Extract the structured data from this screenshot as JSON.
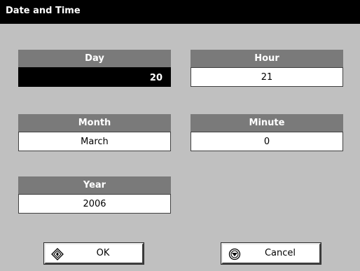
{
  "window": {
    "title": "Date and Time"
  },
  "fields": {
    "day": {
      "label": "Day",
      "value": "20"
    },
    "hour": {
      "label": "Hour",
      "value": "21"
    },
    "month": {
      "label": "Month",
      "value": "March"
    },
    "minute": {
      "label": "Minute",
      "value": "0"
    },
    "year": {
      "label": "Year",
      "value": "2006"
    }
  },
  "buttons": {
    "ok": {
      "label": "OK",
      "icon": "ok-diamond-icon"
    },
    "cancel": {
      "label": "Cancel",
      "icon": "cancel-circle-icon"
    }
  },
  "colors": {
    "titlebar": "#000000",
    "background": "#c0c0c0",
    "label_header": "#7a7a7a",
    "selected_value": "#000000"
  }
}
